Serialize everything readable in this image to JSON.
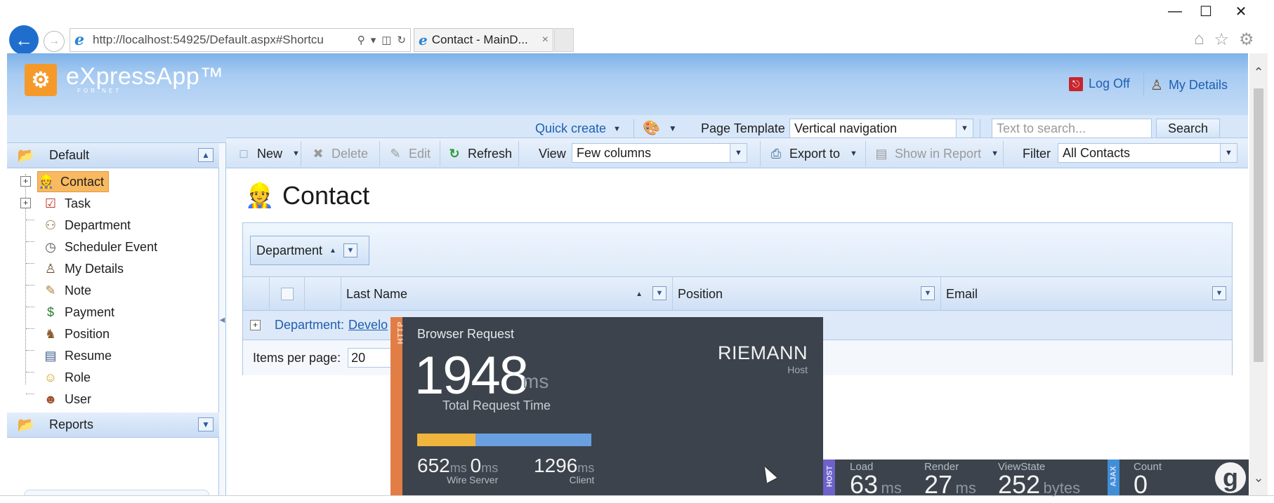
{
  "browser": {
    "url": "http://localhost:54925/Default.aspx#Shortcu",
    "tab_title": "Contact - MainD...",
    "tab_close": "×",
    "window_buttons": {
      "minimize": "—",
      "maximize": "☐",
      "close": "✕"
    }
  },
  "app": {
    "logo_text": "eXpressApp™",
    "logo_sub": "FOR.NET",
    "logoff_label": "Log Off",
    "mydetails_label": "My Details"
  },
  "quickbar": {
    "quick_create_label": "Quick create",
    "page_template_label": "Page Template",
    "page_template_value": "Vertical navigation",
    "search_placeholder": "Text to search...",
    "search_button": "Search"
  },
  "nav": {
    "groups": [
      {
        "label": "Default",
        "expanded": true
      },
      {
        "label": "Reports",
        "expanded": false
      }
    ],
    "items": [
      {
        "label": "Contact",
        "icon": "contact-icon",
        "selected": true,
        "expandable": true
      },
      {
        "label": "Task",
        "icon": "task-icon",
        "selected": false,
        "expandable": true
      },
      {
        "label": "Department",
        "icon": "department-icon",
        "selected": false,
        "expandable": false
      },
      {
        "label": "Scheduler Event",
        "icon": "clock-icon",
        "selected": false,
        "expandable": false
      },
      {
        "label": "My Details",
        "icon": "user-details-icon",
        "selected": false,
        "expandable": false
      },
      {
        "label": "Note",
        "icon": "note-icon",
        "selected": false,
        "expandable": false
      },
      {
        "label": "Payment",
        "icon": "payment-icon",
        "selected": false,
        "expandable": false
      },
      {
        "label": "Position",
        "icon": "position-icon",
        "selected": false,
        "expandable": false
      },
      {
        "label": "Resume",
        "icon": "resume-icon",
        "selected": false,
        "expandable": false
      },
      {
        "label": "Role",
        "icon": "role-icon",
        "selected": false,
        "expandable": false
      },
      {
        "label": "User",
        "icon": "user-icon",
        "selected": false,
        "expandable": false
      }
    ]
  },
  "toolbar": {
    "new_label": "New",
    "delete_label": "Delete",
    "edit_label": "Edit",
    "refresh_label": "Refresh",
    "view_label": "View",
    "view_value": "Few columns",
    "export_label": "Export to",
    "show_in_report_label": "Show in Report",
    "filter_label": "Filter",
    "filter_value": "All Contacts"
  },
  "content": {
    "title": "Contact",
    "group_by": "Department",
    "columns": [
      "Last Name",
      "Position",
      "Email"
    ],
    "group_row_prefix": "Department:",
    "group_row_value": "Develo",
    "items_per_page_label": "Items per page:",
    "items_per_page_value": "20"
  },
  "glimpse": {
    "http_tag": "HTTP",
    "title": "Browser Request",
    "total_time": "1948",
    "total_time_unit": "ms",
    "total_time_label": "Total Request Time",
    "host_name": "RIEMANN",
    "host_label": "Host",
    "wire_fraction": 0.335,
    "metrics": [
      {
        "value": "652",
        "unit": "ms",
        "label": "Wire"
      },
      {
        "value": "0",
        "unit": "ms",
        "label": "Server"
      },
      {
        "value": "1296",
        "unit": "ms",
        "label": "Client"
      }
    ],
    "bar": {
      "host_tag": "HOST",
      "ajax_tag": "AJAX",
      "load": {
        "label": "Load",
        "value": "63",
        "unit": "ms"
      },
      "render": {
        "label": "Render",
        "value": "27",
        "unit": "ms"
      },
      "viewstate": {
        "label": "ViewState",
        "value": "252",
        "unit": "bytes"
      },
      "count": {
        "label": "Count",
        "value": "0"
      },
      "logo": "g"
    }
  },
  "colors": {
    "accent_blue": "#1e5fb1",
    "selection_orange": "#f8b960",
    "glimpse_dark": "#3c434c",
    "glimpse_orange": "#e27e45",
    "wire_yellow": "#f0b53c",
    "client_blue": "#6a9fe0"
  }
}
